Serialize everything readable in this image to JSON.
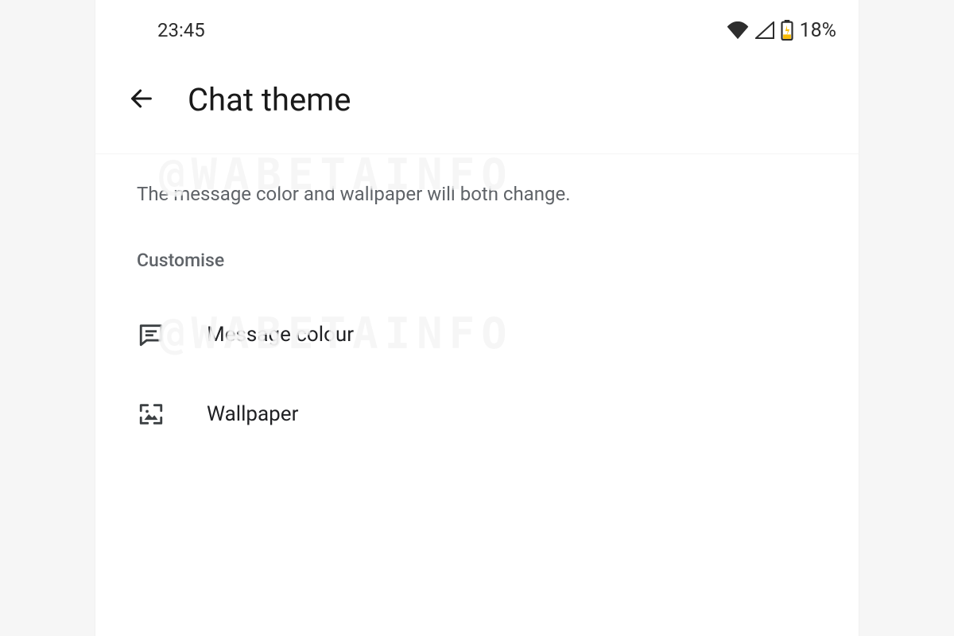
{
  "status_bar": {
    "time": "23:45",
    "wifi_icon": "wifi",
    "signal_icon": "cellular-signal",
    "battery_icon": "battery-charging",
    "battery_text": "18%"
  },
  "header": {
    "back_icon": "arrow-left",
    "title": "Chat theme"
  },
  "description": "The message color and wallpaper will both change.",
  "section_label": "Customise",
  "rows": [
    {
      "icon": "chat-bubble",
      "label": "Message colour"
    },
    {
      "icon": "wallpaper",
      "label": "Wallpaper"
    }
  ],
  "watermark": "@WABETAINFO"
}
